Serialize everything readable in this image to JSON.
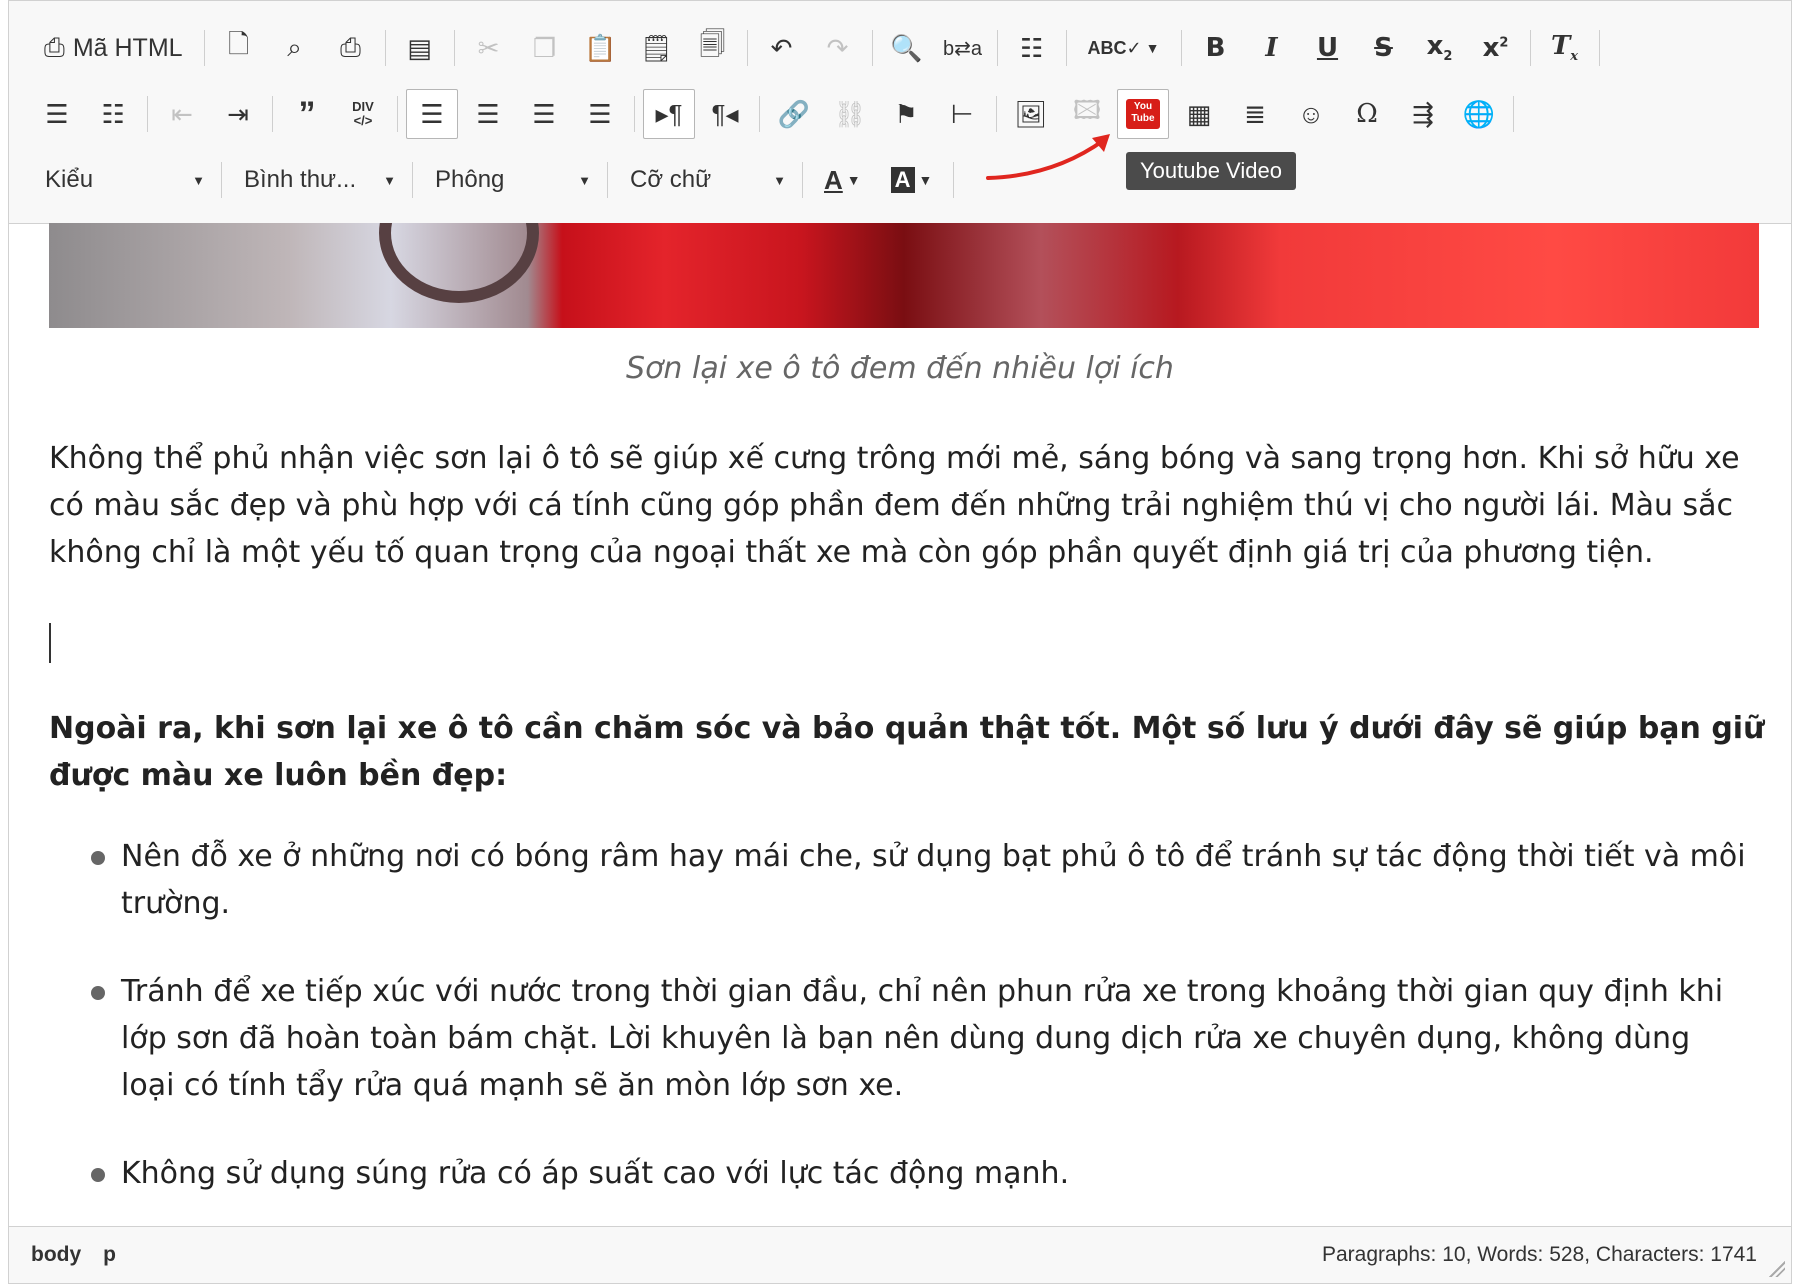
{
  "toolbar": {
    "source_label": "Mã HTML",
    "format_style": "Kiểu",
    "format_paragraph": "Bình thư...",
    "font_name": "Phông",
    "font_size": "Cỡ chữ",
    "tooltip": "Youtube Video",
    "youtube_icon_text": "You Tube",
    "icons_row1": [
      "source-icon",
      "new-page-icon",
      "preview-icon",
      "print-icon",
      "templates-icon",
      "cut-icon",
      "copy-icon",
      "paste-icon",
      "paste-text-icon",
      "paste-word-icon",
      "undo-icon",
      "redo-icon",
      "find-icon",
      "replace-icon",
      "select-all-icon",
      "spellcheck-icon",
      "bold-icon",
      "italic-icon",
      "underline-icon",
      "strike-icon",
      "subscript-icon",
      "superscript-icon",
      "remove-format-icon"
    ],
    "icons_row2": [
      "numbered-list-icon",
      "bulleted-list-icon",
      "outdent-icon",
      "indent-icon",
      "blockquote-icon",
      "div-icon",
      "align-left-icon",
      "align-center-icon",
      "align-right-icon",
      "justify-icon",
      "ltr-icon",
      "rtl-icon",
      "link-icon",
      "unlink-icon",
      "anchor-icon",
      "language-icon",
      "image-icon",
      "flash-icon",
      "youtube-icon",
      "table-icon",
      "horizontal-rule-icon",
      "smiley-icon",
      "special-char-icon",
      "page-break-icon",
      "iframe-icon"
    ],
    "colors": {
      "annotation_arrow": "#e0261f",
      "youtube_red": "#d71e18"
    }
  },
  "content": {
    "caption": "Sơn lại xe ô tô đem đến nhiều lợi ích",
    "paragraph1": "Không thể phủ nhận việc sơn lại ô tô sẽ giúp xế cưng trông mới mẻ, sáng bóng và sang trọng hơn. Khi sở hữu xe có màu sắc đẹp và phù hợp với cá tính cũng góp phần đem đến những trải nghiệm thú vị cho người lái. Màu sắc không chỉ là một yếu tố quan trọng của ngoại thất xe mà còn góp phần quyết định giá trị của phương tiện.",
    "paragraph2": "Ngoài ra, khi sơn lại xe ô tô cần chăm sóc và bảo quản thật tốt. Một số lưu ý dưới đây sẽ giúp bạn giữ được màu xe luôn bền đẹp:",
    "bullets": [
      "Nên đỗ xe ở những nơi có bóng râm hay mái che, sử dụng bạt phủ ô tô để tránh sự tác động thời tiết và môi trường.",
      "Tránh để xe tiếp xúc với nước trong thời gian đầu, chỉ nên phun rửa xe trong khoảng thời gian quy định khi lớp sơn đã hoàn toàn bám chặt. Lời khuyên là bạn nên dùng dung dịch rửa xe chuyên dụng, không dùng loại có tính tẩy rửa quá mạnh sẽ ăn mòn lớp sơn xe.",
      "Không sử dụng súng rửa có áp suất cao với lực tác động mạnh."
    ]
  },
  "status": {
    "path": [
      "body",
      "p"
    ],
    "counts": "Paragraphs: 10, Words: 528, Characters: 1741"
  }
}
